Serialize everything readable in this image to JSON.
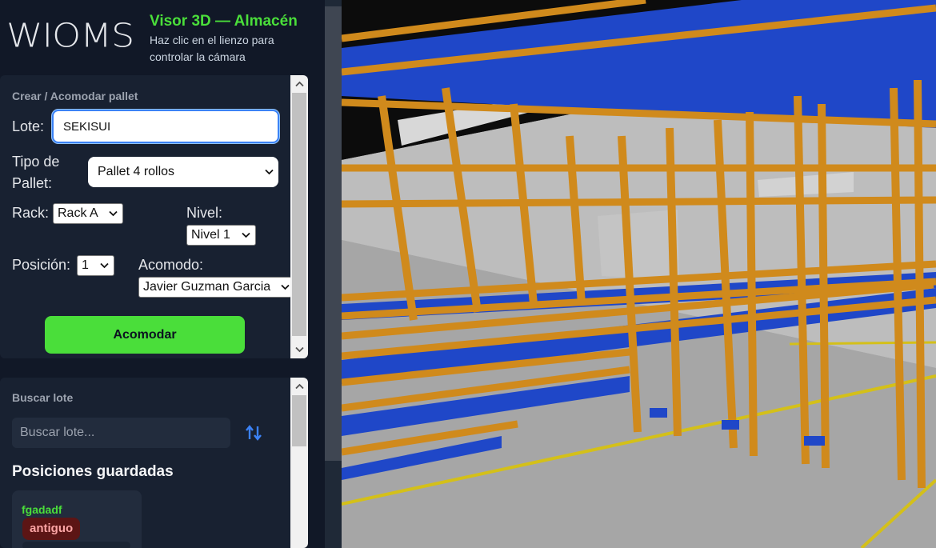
{
  "header": {
    "logo": "WIOMS",
    "title": "Visor 3D — Almacén",
    "subtitle": "Haz clic en el lienzo para controlar la cámara"
  },
  "form": {
    "section_title": "Crear / Acomodar pallet",
    "lote_label": "Lote:",
    "lote_value": "SEKISUI",
    "tipo_label_1": "Tipo de",
    "tipo_label_2": "Pallet:",
    "tipo_value": "Pallet 4 rollos",
    "rack_label": "Rack:",
    "rack_value": "Rack A",
    "nivel_label": "Nivel:",
    "nivel_value": "Nivel 1",
    "posicion_label": "Posición:",
    "posicion_value": "1",
    "acomodo_label": "Acomodo:",
    "acomodo_value": "Javier Guzman Garcia",
    "submit_label": "Acomodar"
  },
  "search": {
    "section_title": "Buscar lote",
    "placeholder": "Buscar lote...",
    "saved_title": "Posiciones guardadas",
    "saved_items": [
      {
        "name": "fgadadf",
        "badge": "antiguo"
      }
    ]
  },
  "colors": {
    "accent_green": "#4ade3a",
    "rack_orange": "#d08a1c",
    "rack_blue": "#1f47c8",
    "floor": "#a8a8a8",
    "badge_bg": "#5c1515"
  },
  "icons": {
    "sort": "sort-arrows-icon",
    "dropdown": "chevron-down-icon",
    "scroll_up": "chevron-up-icon",
    "scroll_down": "chevron-down-icon"
  }
}
